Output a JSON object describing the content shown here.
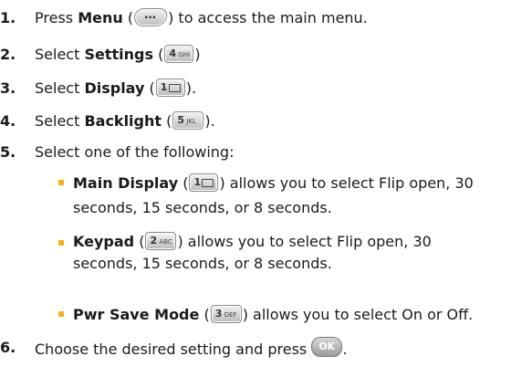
{
  "steps": [
    {
      "num": "1.",
      "pre": "Press ",
      "bold": "Menu",
      "open": " (",
      "key": {
        "label": "…",
        "sub": ""
      },
      "post": ") to access the main menu."
    },
    {
      "num": "2.",
      "pre": "Select ",
      "bold": "Settings",
      "open": " (",
      "key": {
        "label": "4",
        "sub": "GHI"
      },
      "post": ")"
    },
    {
      "num": "3.",
      "pre": "Select ",
      "bold": "Display",
      "open": " (",
      "key": {
        "label": "1",
        "sub": ""
      },
      "post": ")."
    },
    {
      "num": "4.",
      "pre": "Select ",
      "bold": "Backlight",
      "open": " (",
      "key": {
        "label": "5",
        "sub": "JKL"
      },
      "post": ")."
    },
    {
      "num": "5.",
      "text": "Select one of the following:"
    },
    {
      "num": "6.",
      "text": "Choose the desired setting and press",
      "key": {
        "label": "OK"
      },
      "post": "."
    }
  ],
  "options": [
    {
      "bold": "Main Display",
      "open": " (",
      "key": {
        "label": "1",
        "sub": ""
      },
      "text1": ") allows you to select Flip open, 30",
      "text2": "seconds, 15 seconds, or 8 seconds."
    },
    {
      "bold": "Keypad",
      "open": " (",
      "key": {
        "label": "2",
        "sub": "ABC"
      },
      "text1": ") allows you to select Flip open, 30",
      "text2": "seconds, 15 seconds, or 8 seconds."
    },
    {
      "bold": "Pwr Save Mode",
      "open": " (",
      "key": {
        "label": "3",
        "sub": "DEF"
      },
      "text1": ") allows you to select On or Off."
    }
  ],
  "colors": {
    "bullet": "#f2b21a",
    "text": "#1a1a1a"
  }
}
